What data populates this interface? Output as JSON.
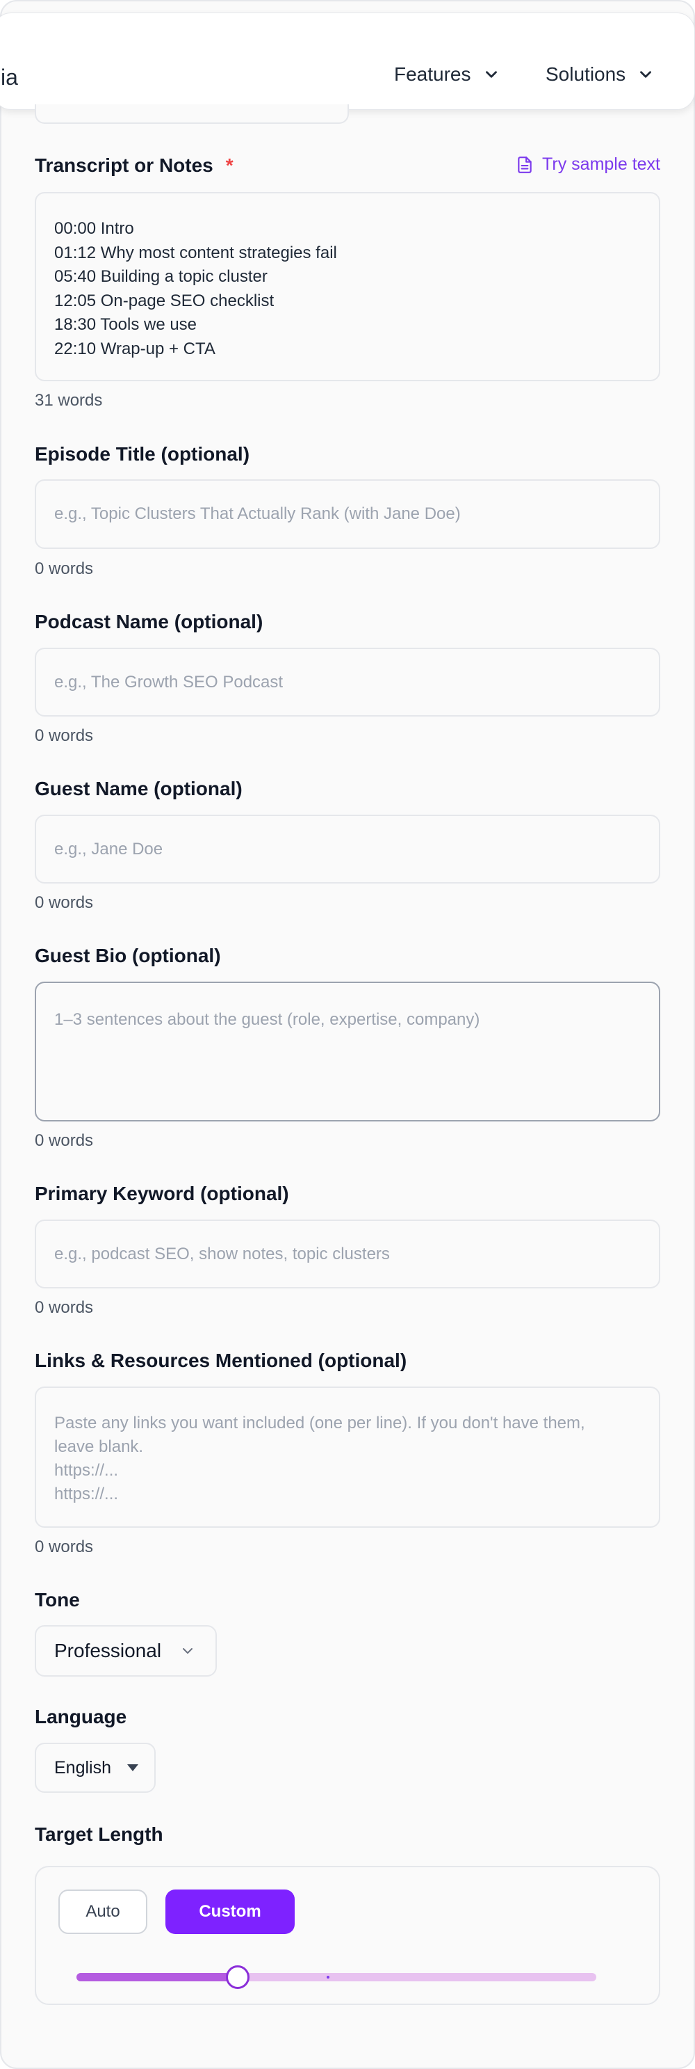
{
  "header": {
    "logo_fragment": "ia",
    "nav": [
      {
        "label": "Features"
      },
      {
        "label": "Solutions"
      }
    ]
  },
  "transcript": {
    "label": "Transcript or Notes",
    "required_mark": "*",
    "sample_link": "Try sample text",
    "lines": [
      "00:00 Intro",
      "01:12 Why most content strategies fail",
      "05:40 Building a topic cluster",
      "12:05 On-page SEO checklist",
      "18:30 Tools we use",
      "22:10 Wrap-up + CTA"
    ],
    "counter": "31 words"
  },
  "episode_title": {
    "label": "Episode Title (optional)",
    "placeholder": "e.g., Topic Clusters That Actually Rank (with Jane Doe)",
    "value": "",
    "counter": "0 words"
  },
  "podcast_name": {
    "label": "Podcast Name (optional)",
    "placeholder": "e.g., The Growth SEO Podcast",
    "value": "",
    "counter": "0 words"
  },
  "guest_name": {
    "label": "Guest Name (optional)",
    "placeholder": "e.g., Jane Doe",
    "value": "",
    "counter": "0 words"
  },
  "guest_bio": {
    "label": "Guest Bio (optional)",
    "placeholder": "1–3 sentences about the guest (role, expertise, company)",
    "value": "",
    "counter": "0 words"
  },
  "primary_keyword": {
    "label": "Primary Keyword (optional)",
    "placeholder": "e.g., podcast SEO, show notes, topic clusters",
    "value": "",
    "counter": "0 words"
  },
  "links": {
    "label": "Links & Resources Mentioned (optional)",
    "placeholder_lines": [
      "Paste any links you want included (one per line). If you don't have them,",
      "leave blank.",
      "https://...",
      "https://..."
    ],
    "counter": "0 words"
  },
  "tone": {
    "label": "Tone",
    "selected": "Professional"
  },
  "language": {
    "label": "Language",
    "selected": "English"
  },
  "target_length": {
    "label": "Target Length",
    "options": [
      "Auto",
      "Custom"
    ],
    "active": "Custom",
    "slider_fraction": 0.31
  },
  "colors": {
    "accent": "#7e22ff",
    "required": "#ef4444",
    "link": "#7c3aed"
  }
}
